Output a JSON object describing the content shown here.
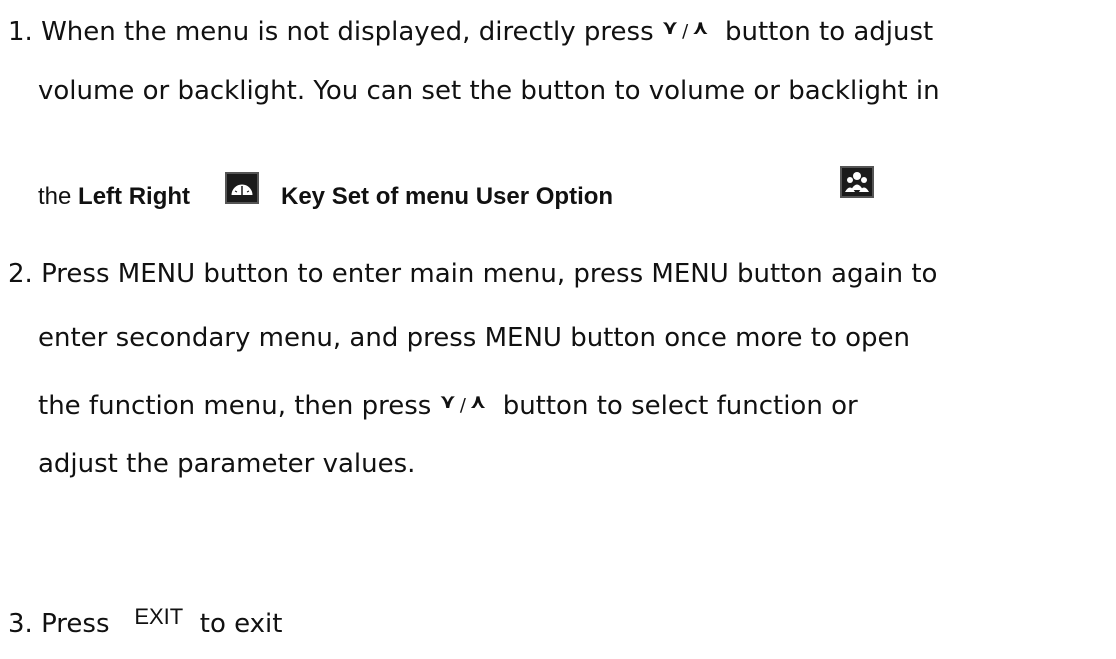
{
  "steps": [
    {
      "number": "1.",
      "line1_a": "When the menu is not displayed, directly press",
      "line1_b": "button to adjust",
      "line2": "volume or backlight. You can set the button to volume or backlight in",
      "line3_the": "the",
      "line3_bold1": "Left Right",
      "line3_bold2": "Key Set of menu User Option"
    },
    {
      "number": "2.",
      "line1": "Press MENU button to enter main menu, press MENU button again to",
      "line2": "enter secondary menu, and press MENU button once more to open",
      "line3_a": "the function menu, then press",
      "line3_b": "button to select function or",
      "line4": "adjust the parameter values."
    },
    {
      "number": "3.",
      "text_a": "Press",
      "exit_label": "EXIT",
      "text_b": "to exit"
    }
  ],
  "symbols": {
    "down": "⋎",
    "up": "⋏",
    "separator": "/"
  },
  "icons": {
    "left_right_icon": "gauge-icon",
    "user_option_icon": "users-icon"
  }
}
